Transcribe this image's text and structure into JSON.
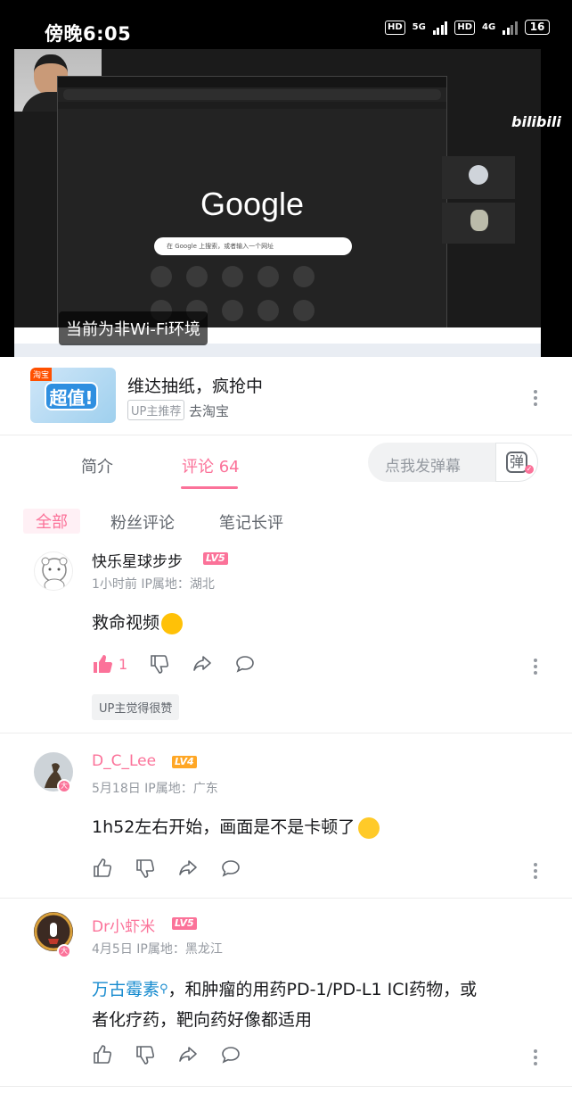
{
  "status_bar": {
    "time": "傍晚6:05",
    "signal_1": "5G",
    "signal_2": "4G",
    "battery": "16"
  },
  "video": {
    "google_logo": "Google",
    "google_search_placeholder": "在 Google 上搜索，或者输入一个网址",
    "network_toast": "当前为非Wi-Fi环境",
    "watermark": "bilibili"
  },
  "ad": {
    "thumb_label": "淘宝",
    "thumb_badge": "超值!",
    "title": "维达抽纸，疯抢中",
    "tag": "UP主推荐",
    "link": "去淘宝"
  },
  "tabs": {
    "intro": "简介",
    "comments": "评论 64",
    "danmu_placeholder": "点我发弹幕",
    "danmu_button": "弹"
  },
  "filters": [
    "全部",
    "粉丝评论",
    "笔记长评"
  ],
  "comments": [
    {
      "username": "快乐星球步步",
      "level": "LV5",
      "meta": "1小时前  IP属地：湖北",
      "text": "救命视频",
      "likes": "1",
      "up_liked": "UP主觉得很赞"
    },
    {
      "username": "D_C_Lee",
      "level": "LV4",
      "meta": "5月18日  IP属地：广东",
      "text": "1h52左右开始，画面是不是卡顿了"
    },
    {
      "username": "Dr小虾米",
      "level": "LV5",
      "meta": "4月5日  IP属地：黑龙江",
      "link_text": "万古霉素",
      "text_line1": "，和肿瘤的用药PD-1/PD-L1 ICI药物，或",
      "text_line2": "者化疗药，靶向药好像都适用"
    }
  ],
  "colors": {
    "accent": "#fb7299",
    "link": "#178bcf",
    "lv5": "#fb7299",
    "lv4": "#ffa726"
  }
}
